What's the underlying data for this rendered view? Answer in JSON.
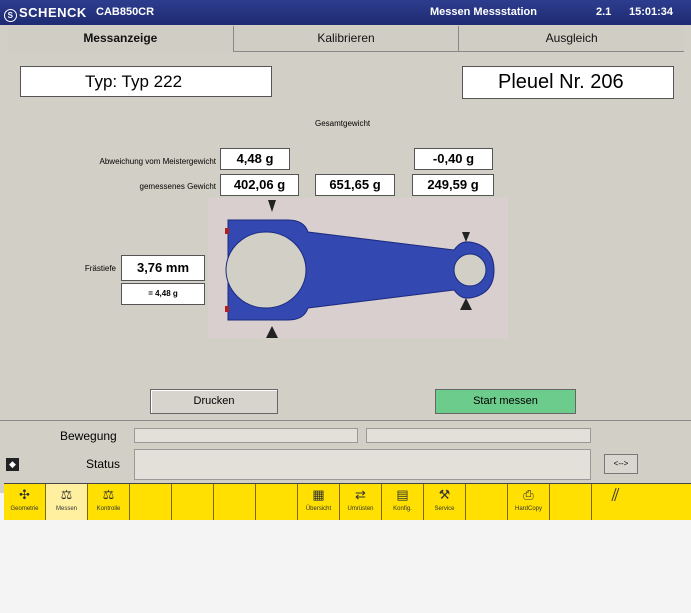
{
  "titlebar": {
    "brand": "SCHENCK",
    "model": "CAB850CR",
    "station": "Messen Messstation",
    "version": "2.1",
    "time": "15:01:34"
  },
  "tabs": [
    {
      "label": "Messanzeige",
      "active": true
    },
    {
      "label": "Kalibrieren",
      "active": false
    },
    {
      "label": "Ausgleich",
      "active": false
    }
  ],
  "typ": {
    "value": "Typ: Typ 222"
  },
  "pleuel": {
    "value": "Pleuel Nr.  206"
  },
  "measure": {
    "gesamt_label": "Gesamtgewicht",
    "abweichung_label": "Abweichung vom Meistergewicht",
    "abweichung_left": "4,48 g",
    "abweichung_right": "-0,40 g",
    "gewicht_label": "gemessenes Gewicht",
    "gewicht_left": "402,06 g",
    "gewicht_total": "651,65 g",
    "gewicht_right": "249,59 g",
    "fraestiefe_label": "Frästiefe",
    "fraestiefe_value": "3,76 mm",
    "fraestiefe_equiv": "= 4,48 g"
  },
  "buttons": {
    "drucken": "Drucken",
    "start": "Start messen"
  },
  "status": {
    "bewegung_label": "Bewegung",
    "status_label": "Status",
    "nav_label": "<-->"
  },
  "toolbar": [
    {
      "label": "Geometrie",
      "icon": "geometry-icon"
    },
    {
      "label": "Messen",
      "icon": "measure-icon",
      "active": true
    },
    {
      "label": "Kontrolle",
      "icon": "control-icon"
    },
    {
      "label": "",
      "icon": ""
    },
    {
      "label": "",
      "icon": ""
    },
    {
      "label": "",
      "icon": ""
    },
    {
      "label": "",
      "icon": ""
    },
    {
      "label": "Übersicht",
      "icon": "overview-icon"
    },
    {
      "label": "Umrüsten",
      "icon": "retool-icon"
    },
    {
      "label": "Konfig.",
      "icon": "config-icon"
    },
    {
      "label": "Service",
      "icon": "service-icon"
    },
    {
      "label": "",
      "icon": ""
    },
    {
      "label": "HardCopy",
      "icon": "print-icon"
    },
    {
      "label": "",
      "icon": ""
    },
    {
      "label": "",
      "icon": "logo-icon"
    }
  ],
  "colors": {
    "rod": "#3348b0",
    "accent": "#ffe000",
    "start": "#6ccc8c",
    "title": "#1e2a72"
  }
}
